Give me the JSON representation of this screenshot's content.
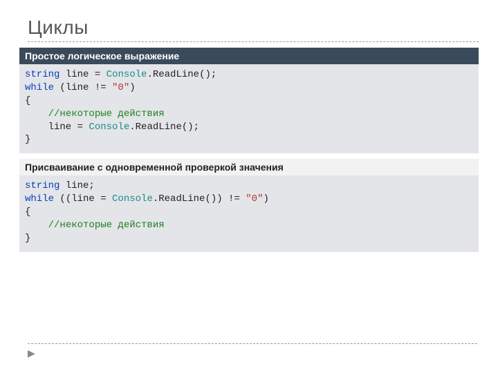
{
  "title": "Циклы",
  "sections": [
    {
      "header": "Простое логическое выражение",
      "header_style": "dark",
      "code": {
        "tokens": [
          [
            {
              "t": "string",
              "c": "kw"
            },
            {
              "t": " line = ",
              "c": ""
            },
            {
              "t": "Console",
              "c": "cls"
            },
            {
              "t": ".ReadLine();",
              "c": ""
            }
          ],
          [
            {
              "t": "while",
              "c": "kw"
            },
            {
              "t": " (line != ",
              "c": ""
            },
            {
              "t": "\"0\"",
              "c": "str"
            },
            {
              "t": ")",
              "c": ""
            }
          ],
          [
            {
              "t": "{",
              "c": ""
            }
          ],
          [
            {
              "t": "    ",
              "c": ""
            },
            {
              "t": "//некоторые действия",
              "c": "cmt"
            }
          ],
          [
            {
              "t": "    line = ",
              "c": ""
            },
            {
              "t": "Console",
              "c": "cls"
            },
            {
              "t": ".ReadLine();",
              "c": ""
            }
          ],
          [
            {
              "t": "}",
              "c": ""
            }
          ]
        ]
      }
    },
    {
      "header": "Присваивание с одновременной проверкой значения",
      "header_style": "light",
      "code": {
        "tokens": [
          [
            {
              "t": "string",
              "c": "kw"
            },
            {
              "t": " line;",
              "c": ""
            }
          ],
          [
            {
              "t": "while",
              "c": "kw"
            },
            {
              "t": " ((line = ",
              "c": ""
            },
            {
              "t": "Console",
              "c": "cls"
            },
            {
              "t": ".ReadLine()) != ",
              "c": ""
            },
            {
              "t": "\"0\"",
              "c": "str"
            },
            {
              "t": ")",
              "c": ""
            }
          ],
          [
            {
              "t": "{",
              "c": ""
            }
          ],
          [
            {
              "t": "    ",
              "c": ""
            },
            {
              "t": "//некоторые действия",
              "c": "cmt"
            }
          ],
          [
            {
              "t": "}",
              "c": ""
            }
          ]
        ]
      }
    }
  ],
  "footer_arrow": "▶"
}
